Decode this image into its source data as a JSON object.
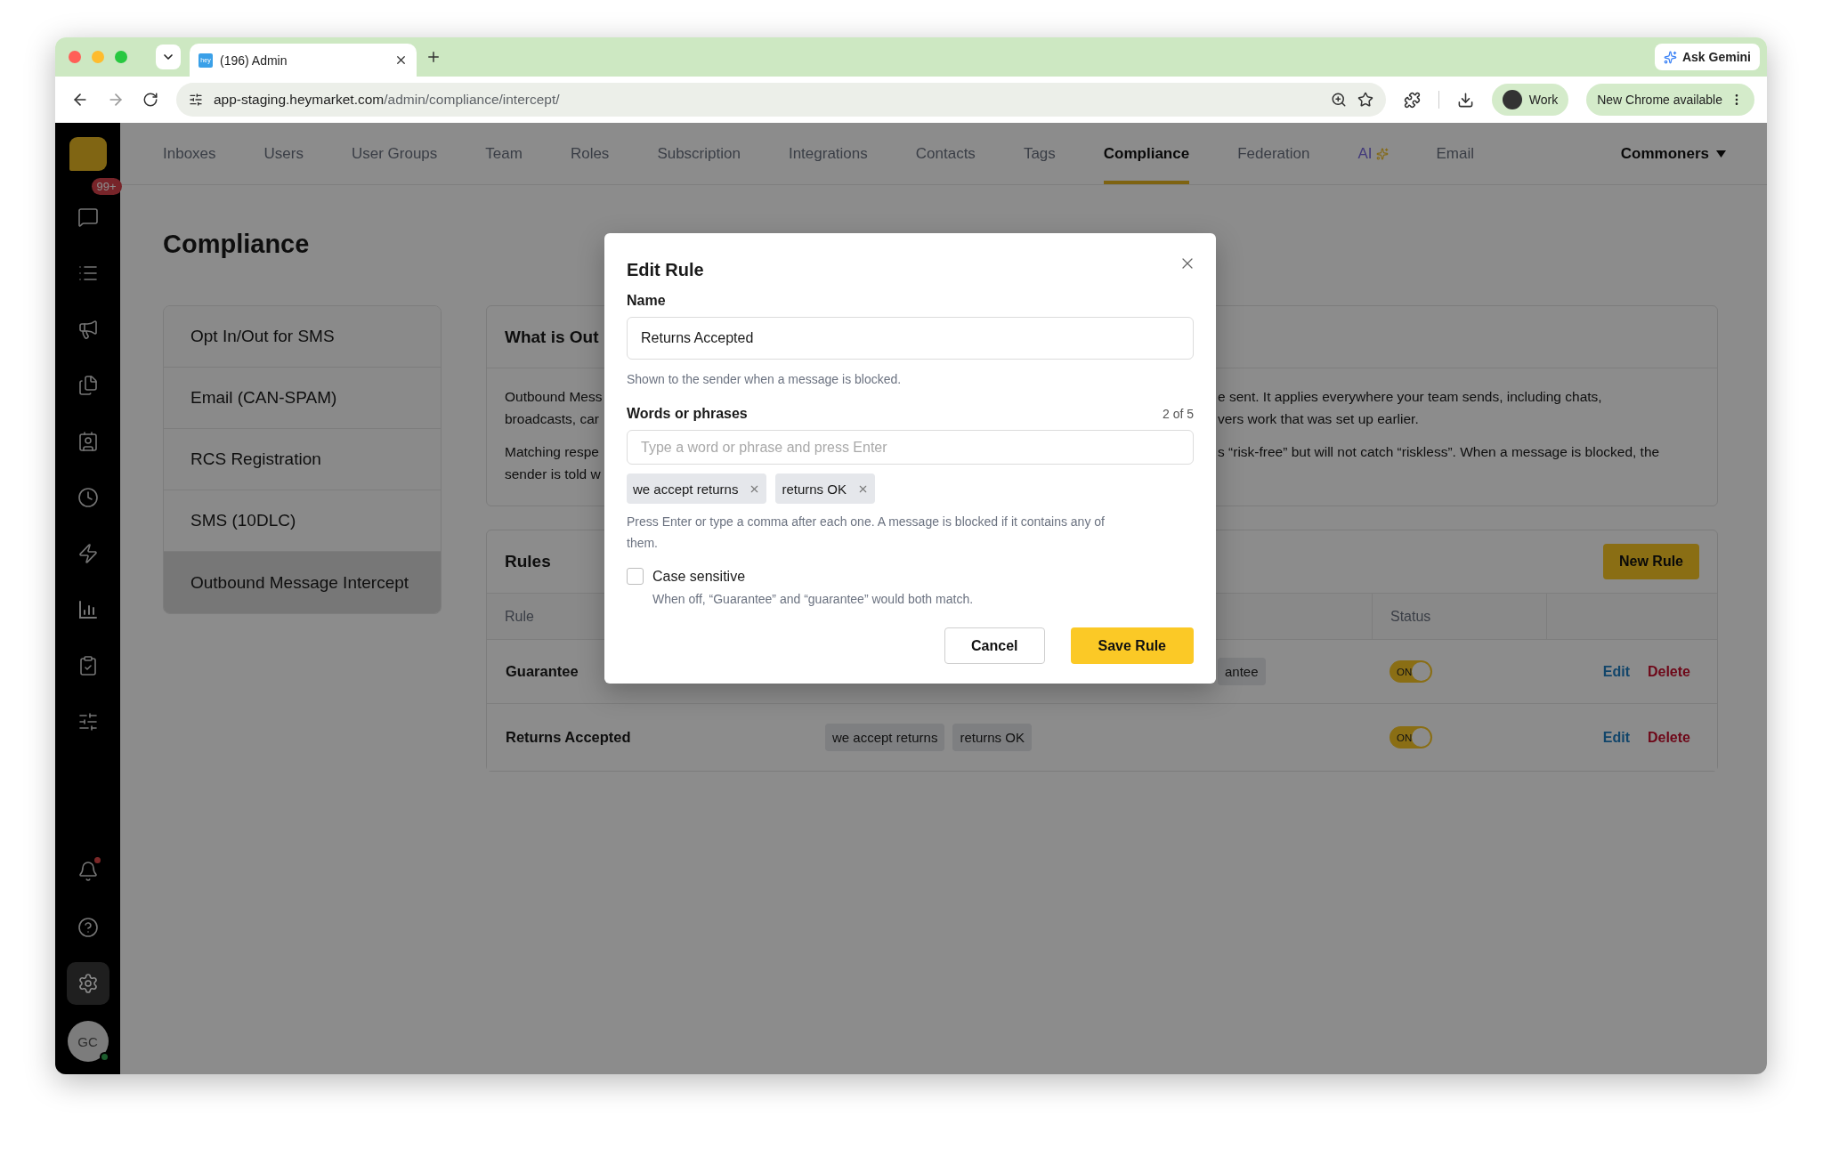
{
  "browser": {
    "favicon": "hey",
    "tab_title": "(196) Admin",
    "url_host": "app-staging.heymarket.com",
    "url_path": "/admin/compliance/intercept/",
    "gemini": "Ask Gemini",
    "profile": "Work",
    "update": "New Chrome available"
  },
  "sidebar": {
    "top_items": [
      {
        "badge": "99+",
        "selected": false
      },
      {
        "selected": false
      },
      {
        "selected": false
      },
      {
        "selected": false
      },
      {
        "selected": false
      },
      {
        "selected": false
      },
      {
        "selected": false
      },
      {
        "selected": false
      },
      {
        "selected": false
      },
      {
        "selected": false
      }
    ],
    "bottom_items": [
      {
        "dot": true,
        "selected": false
      },
      {
        "selected": false
      },
      {
        "selected": true
      }
    ],
    "avatar": "GC",
    "online": true
  },
  "nav": {
    "tabs": [
      {
        "label": "Inboxes",
        "kind": "page",
        "selected": false
      },
      {
        "label": "Users",
        "kind": "page",
        "selected": false
      },
      {
        "label": "User Groups",
        "kind": "page",
        "selected": false
      },
      {
        "label": "Team",
        "kind": "page",
        "selected": false
      },
      {
        "label": "Roles",
        "kind": "page",
        "selected": false
      },
      {
        "label": "Subscription",
        "kind": "page",
        "selected": false
      },
      {
        "label": "Integrations",
        "kind": "page",
        "selected": false
      },
      {
        "label": "Contacts",
        "kind": "page",
        "selected": false
      },
      {
        "label": "Tags",
        "kind": "page",
        "selected": false
      },
      {
        "label": "Compliance",
        "kind": "page",
        "selected": true
      },
      {
        "label": "Federation",
        "kind": "page",
        "selected": false
      },
      {
        "label": "AI",
        "kind": "feature",
        "selected": false
      },
      {
        "label": "Email",
        "kind": "page",
        "selected": false
      }
    ],
    "account": "Commoners"
  },
  "page": {
    "title": "Compliance",
    "menu": [
      {
        "label": "Opt In/Out for SMS",
        "selected": false
      },
      {
        "label": "Email (CAN-SPAM)",
        "selected": false
      },
      {
        "label": "RCS Registration",
        "selected": false
      },
      {
        "label": "SMS (10DLC)",
        "selected": false
      },
      {
        "label": "Outbound Message Intercept",
        "selected": true
      }
    ],
    "info": {
      "title": "What is Out",
      "paragraphs": [
        {
          "left": [
            "Outbound Mess",
            "broadcasts, car"
          ],
          "right": [
            "e sent. It applies everywhere your team sends, including chats,",
            "vers work that was set up earlier."
          ]
        },
        {
          "left": [
            "Matching respe",
            "sender is told w"
          ],
          "right": [
            "s “risk-free” but will not catch “riskless”. When a message is blocked, the"
          ]
        }
      ]
    },
    "rules": {
      "title": "Rules",
      "new_button": "New Rule",
      "columns": [
        "Rule",
        "Status"
      ],
      "rows": [
        {
          "name": "Guarantee",
          "kind": "covered",
          "tags": [
            "antee"
          ],
          "on": true,
          "toggle_label": "ON",
          "edit": "Edit",
          "delete": "Delete"
        },
        {
          "name": "Returns Accepted",
          "kind": "full",
          "tags": [
            "we accept returns",
            "returns OK"
          ],
          "on": true,
          "toggle_label": "ON",
          "edit": "Edit",
          "delete": "Delete"
        }
      ]
    }
  },
  "modal": {
    "title": "Edit Rule",
    "name_label": "Name",
    "name_value": "Returns Accepted",
    "name_help": "Shown to the sender when a message is blocked.",
    "words_label": "Words or phrases",
    "words_count": "2 of 5",
    "words_placeholder": "Type a word or phrase and press Enter",
    "chips": [
      "we accept returns",
      "returns OK"
    ],
    "words_help": "Press Enter or type a comma after each one. A message is blocked if it contains any of them.",
    "case_label": "Case sensitive",
    "case_sensitive": false,
    "case_help": "When off, “Guarantee” and “guarantee” would both match.",
    "cancel": "Cancel",
    "save": "Save Rule"
  }
}
